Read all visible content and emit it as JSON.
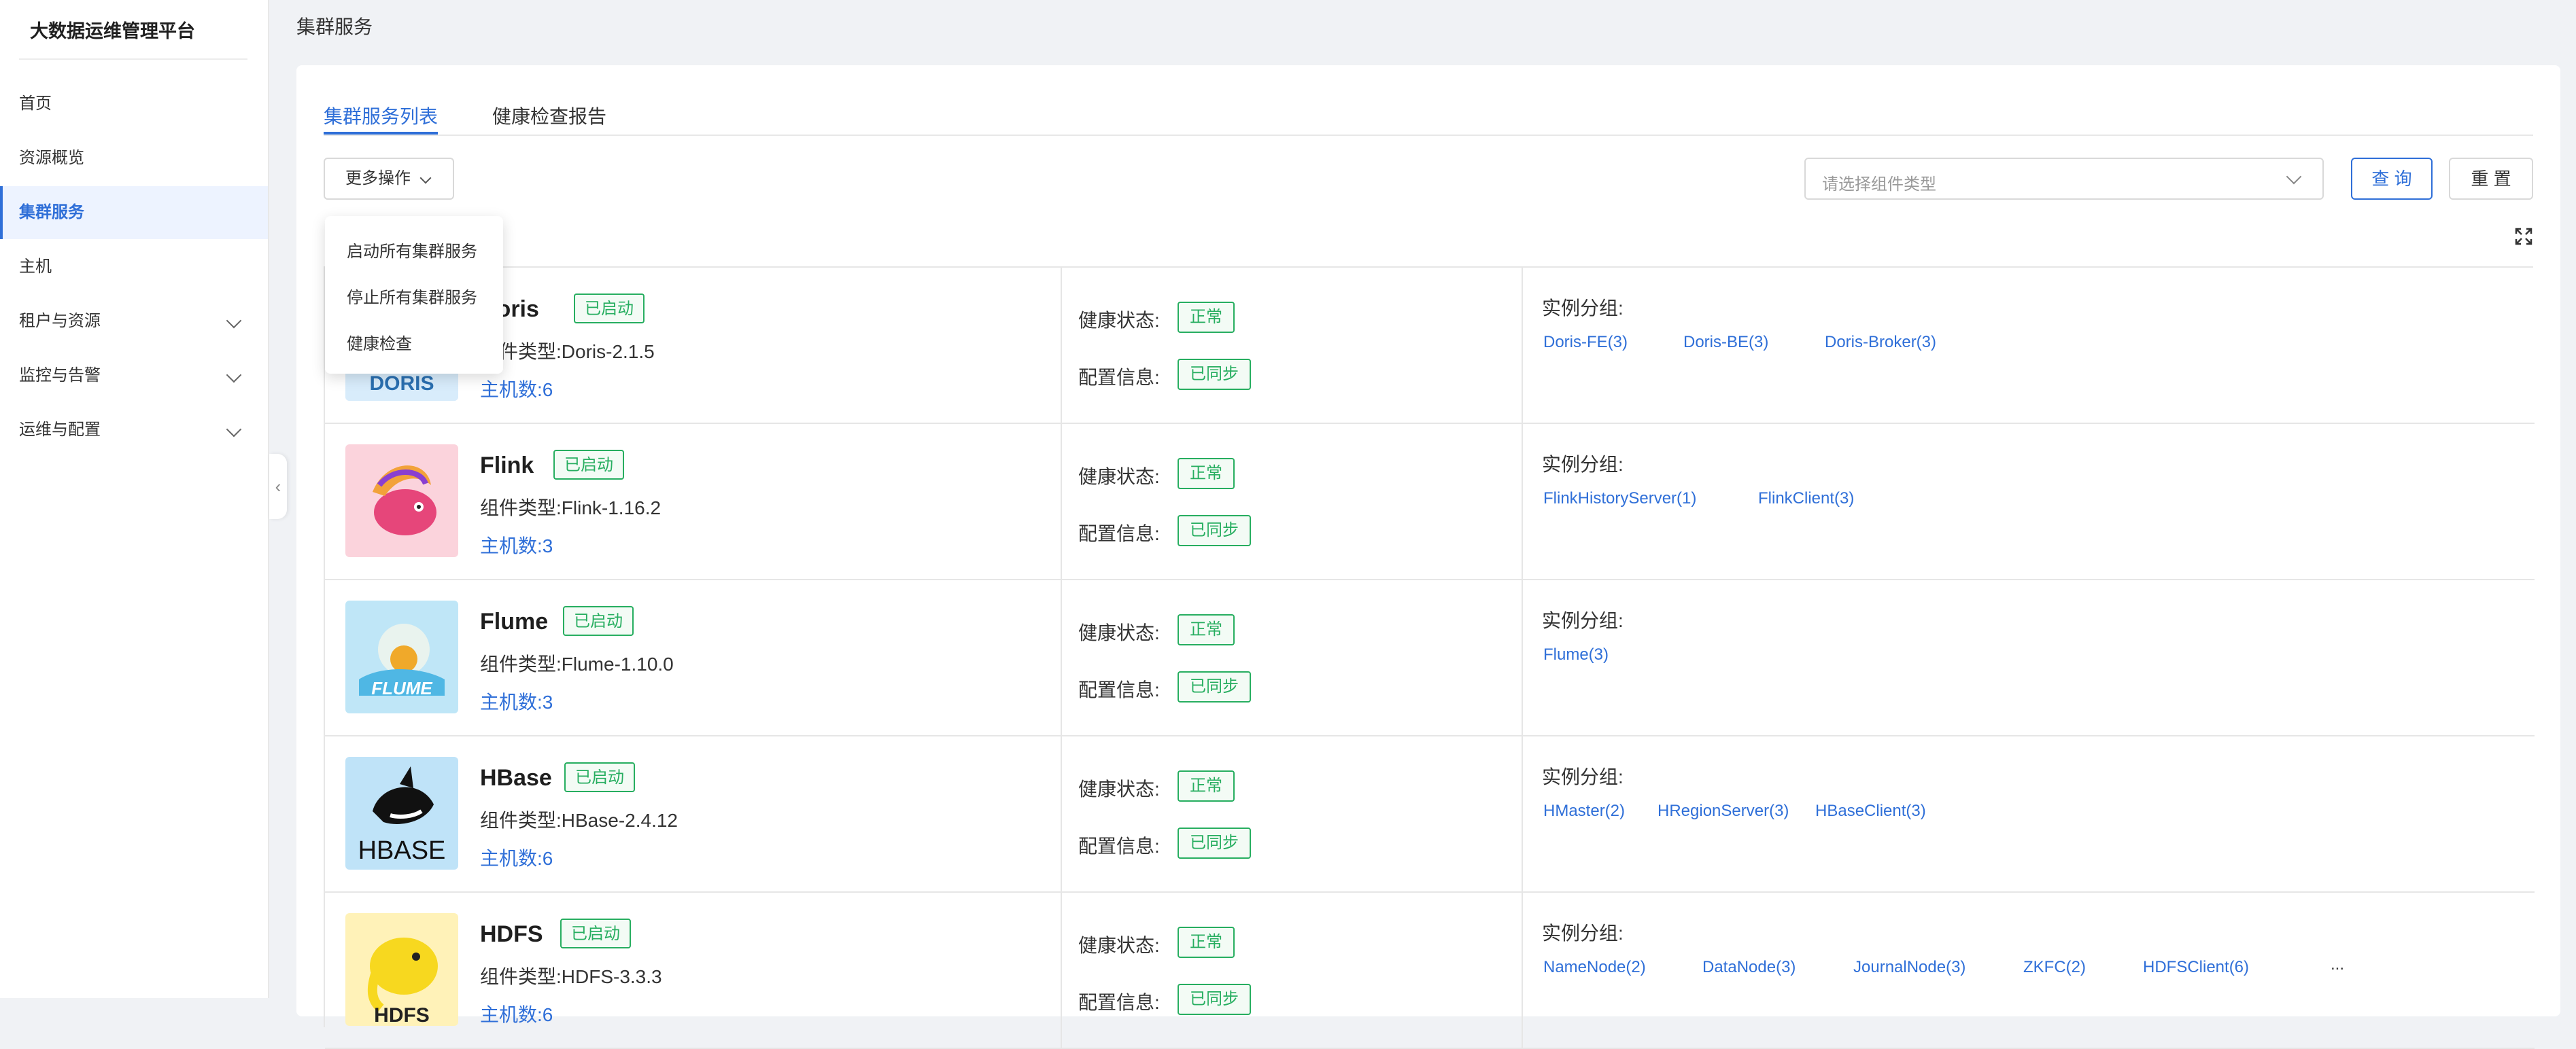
{
  "app": {
    "title": "大数据运维管理平台"
  },
  "sidebar": {
    "items": [
      {
        "label": "首页",
        "active": false,
        "expandable": false
      },
      {
        "label": "资源概览",
        "active": false,
        "expandable": false
      },
      {
        "label": "集群服务",
        "active": true,
        "expandable": false
      },
      {
        "label": "主机",
        "active": false,
        "expandable": false
      },
      {
        "label": "租户与资源",
        "active": false,
        "expandable": true
      },
      {
        "label": "监控与告警",
        "active": false,
        "expandable": true
      },
      {
        "label": "运维与配置",
        "active": false,
        "expandable": true
      }
    ],
    "collapse_icon": "‹"
  },
  "header": {
    "title": "集群服务"
  },
  "tabs": [
    {
      "label": "集群服务列表",
      "active": true
    },
    {
      "label": "健康检查报告",
      "active": false
    }
  ],
  "toolbar": {
    "more_label": "更多操作",
    "select_placeholder": "请选择组件类型",
    "query_label": "查 询",
    "reset_label": "重 置"
  },
  "dropdown": {
    "items": [
      "启动所有集群服务",
      "停止所有集群服务",
      "健康检查"
    ]
  },
  "labels": {
    "health": "健康状态:",
    "config": "配置信息:",
    "groups": "实例分组:",
    "type_prefix": "组件类型:",
    "hosts_prefix": "主机数:"
  },
  "colors": {
    "accent": "#2f6fd8",
    "success": "#27ae60"
  },
  "services": [
    {
      "name": "Doris",
      "status": "已启动",
      "type": "组件类型:Doris-2.1.5",
      "hosts": "主机数:6",
      "health": "正常",
      "config": "已同步",
      "logo_text": "DORIS",
      "instances": [
        "Doris-FE(3)",
        "Doris-BE(3)",
        "Doris-Broker(3)"
      ],
      "more": ""
    },
    {
      "name": "Flink",
      "status": "已启动",
      "type": "组件类型:Flink-1.16.2",
      "hosts": "主机数:3",
      "health": "正常",
      "config": "已同步",
      "logo_text": "",
      "instances": [
        "FlinkHistoryServer(1)",
        "FlinkClient(3)"
      ],
      "more": ""
    },
    {
      "name": "Flume",
      "status": "已启动",
      "type": "组件类型:Flume-1.10.0",
      "hosts": "主机数:3",
      "health": "正常",
      "config": "已同步",
      "logo_text": "FLUME",
      "instances": [
        "Flume(3)"
      ],
      "more": ""
    },
    {
      "name": "HBase",
      "status": "已启动",
      "type": "组件类型:HBase-2.4.12",
      "hosts": "主机数:6",
      "health": "正常",
      "config": "已同步",
      "logo_text": "HBASE",
      "instances": [
        "HMaster(2)",
        "HRegionServer(3)",
        "HBaseClient(3)"
      ],
      "more": ""
    },
    {
      "name": "HDFS",
      "status": "已启动",
      "type": "组件类型:HDFS-3.3.3",
      "hosts": "主机数:6",
      "health": "正常",
      "config": "已同步",
      "logo_text": "HDFS",
      "instances": [
        "NameNode(2)",
        "DataNode(3)",
        "JournalNode(3)",
        "ZKFC(2)",
        "HDFSClient(6)"
      ],
      "more": "..."
    }
  ]
}
